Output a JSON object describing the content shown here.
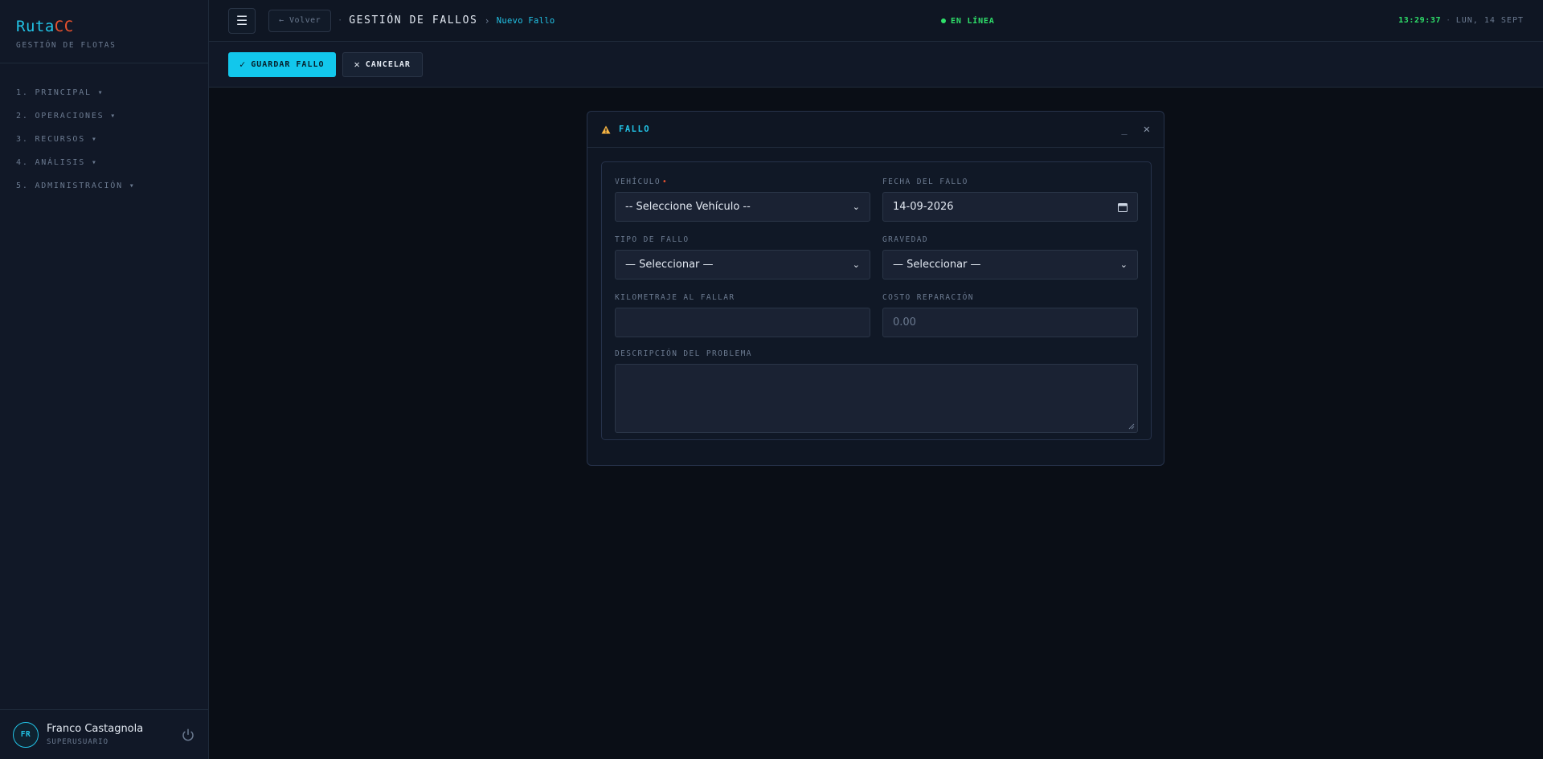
{
  "sidebar": {
    "brand_a": "Ruta",
    "brand_b": "CC",
    "subtitle": "GESTIÓN DE FLOTAS",
    "nav": [
      {
        "label": "1. PRINCIPAL ▾"
      },
      {
        "label": "2. OPERACIONES ▾"
      },
      {
        "label": "3. RECURSOS ▾"
      },
      {
        "label": "4. ANÁLISIS ▾"
      },
      {
        "label": "5. ADMINISTRACIÓN ▾"
      }
    ],
    "user": {
      "initials": "FR",
      "name": "Franco Castagnola",
      "role": "SUPERUSUARIO"
    }
  },
  "topbar": {
    "back_label": "← Volver",
    "breadcrumb_main": "GESTIÓN DE FALLOS",
    "breadcrumb_sub": "Nuevo Fallo",
    "status": "EN LÍNEA",
    "time": "13:29:37",
    "date": "LUN, 14 SEPT"
  },
  "toolbar": {
    "save_label": "GUARDAR FALLO",
    "cancel_label": "CANCELAR"
  },
  "modal": {
    "title": "FALLO",
    "minimize": "_",
    "fields": {
      "vehiculo": {
        "label": "VEHÍCULO",
        "value": "-- Seleccione Vehículo --"
      },
      "fecha": {
        "label": "FECHA DEL FALLO",
        "value": "14-09-2026"
      },
      "tipo": {
        "label": "TIPO DE FALLO",
        "value": "— Seleccionar —"
      },
      "gravedad": {
        "label": "GRAVEDAD",
        "value": "— Seleccionar —"
      },
      "km": {
        "label": "KILOMETRAJE AL FALLAR",
        "value": ""
      },
      "costo": {
        "label": "COSTO REPARACIÓN",
        "placeholder": "0.00"
      },
      "descripcion": {
        "label": "DESCRIPCIÓN DEL PROBLEMA",
        "value": ""
      }
    }
  },
  "colors": {
    "accent": "#22c3e6",
    "brand_red": "#e8522e",
    "online": "#2fe06a",
    "warning": "#f5b342"
  }
}
